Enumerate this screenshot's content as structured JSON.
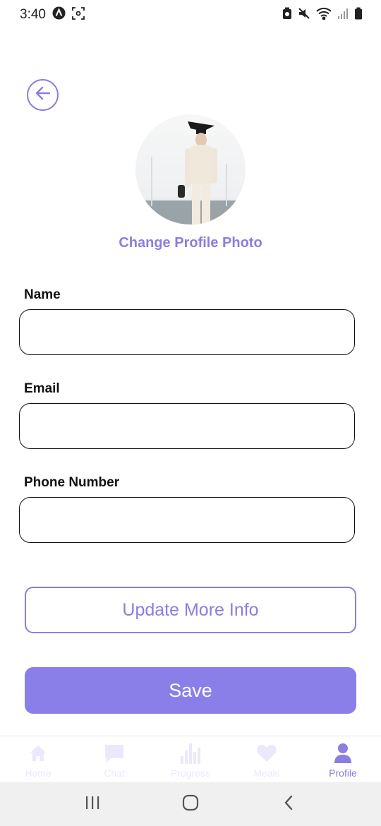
{
  "status_bar": {
    "time": "3:40"
  },
  "profile": {
    "change_photo_label": "Change Profile Photo"
  },
  "form": {
    "name_label": "Name",
    "name_value": "",
    "email_label": "Email",
    "email_value": "",
    "phone_label": "Phone Number",
    "phone_value": ""
  },
  "buttons": {
    "update_label": "Update More Info",
    "save_label": "Save"
  },
  "tab_bar": {
    "tabs": [
      {
        "label": "Home",
        "icon": "home-icon"
      },
      {
        "label": "Chat",
        "icon": "chat-icon"
      },
      {
        "label": "Progress",
        "icon": "bar-chart-icon"
      },
      {
        "label": "Meals",
        "icon": "heart-icon"
      },
      {
        "label": "Profile",
        "icon": "user-icon"
      }
    ],
    "active_tab": "Profile"
  },
  "colors": {
    "accent": "#8a7ee0",
    "save_bg": "#8a7ee8",
    "inactive_tab": "#ebe8fb"
  }
}
